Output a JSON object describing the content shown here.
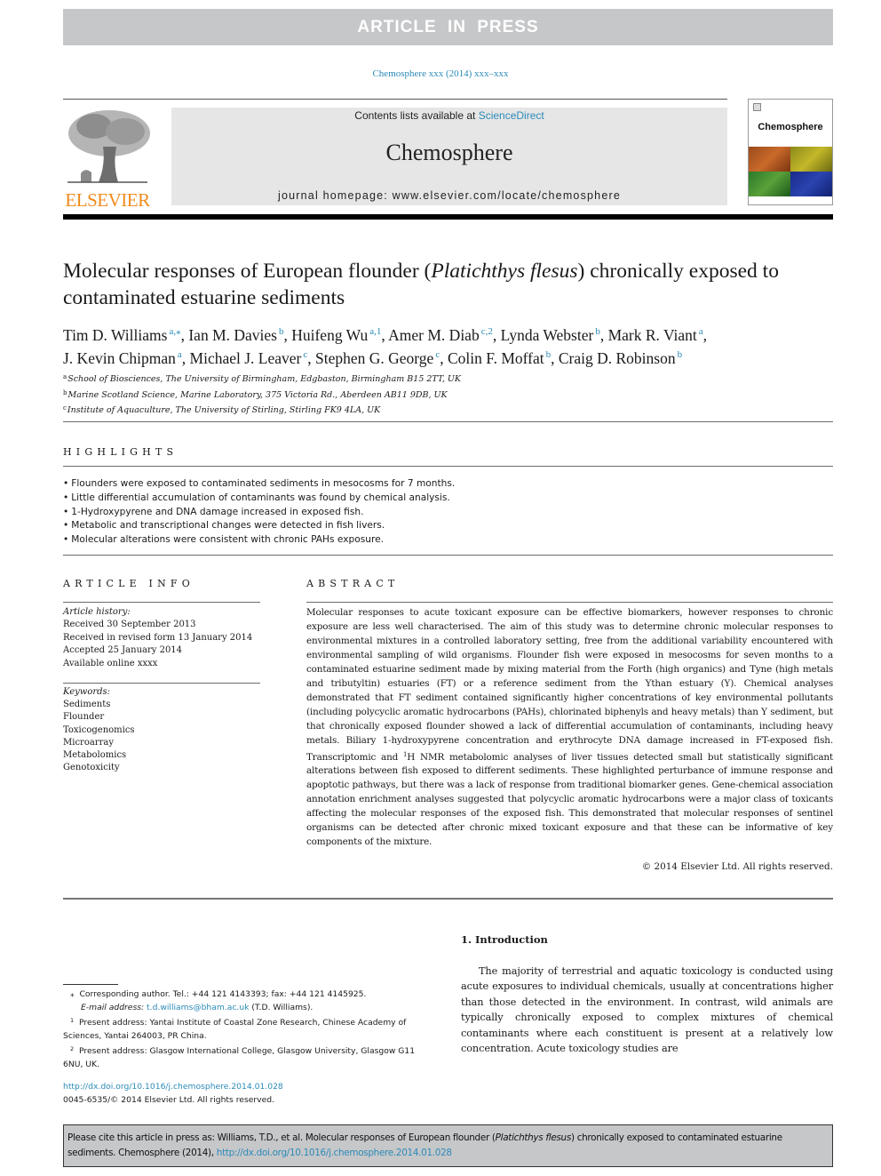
{
  "banner": {
    "label": "ARTICLE IN PRESS"
  },
  "journal_ref": "Chemosphere xxx (2014) xxx–xxx",
  "header": {
    "publisher_logo_text": "ELSEVIER",
    "contents_prefix": "Contents lists available at ",
    "contents_link": "ScienceDirect",
    "journal_title": "Chemosphere",
    "homepage_prefix": "journal homepage: ",
    "homepage_url": "www.elsevier.com/locate/chemosphere",
    "cover_title": "Chemosphere"
  },
  "article": {
    "title_part1": "Molecular responses of European flounder (",
    "title_italic": "Platichthys flesus",
    "title_part2": ") chronically exposed to contaminated estuarine sediments",
    "authors": [
      {
        "name": "Tim D. Williams",
        "sup": "a,⁎",
        "sep": ", "
      },
      {
        "name": "Ian M. Davies",
        "sup": "b",
        "sep": ", "
      },
      {
        "name": "Huifeng Wu",
        "sup": "a,1",
        "sep": ", "
      },
      {
        "name": "Amer M. Diab",
        "sup": "c,2",
        "sep": ", "
      },
      {
        "name": "Lynda Webster",
        "sup": "b",
        "sep": ", "
      },
      {
        "name": "Mark R. Viant",
        "sup": "a",
        "sep": ","
      },
      {
        "name": "J. Kevin Chipman",
        "sup": "a",
        "sep": ", "
      },
      {
        "name": "Michael J. Leaver",
        "sup": "c",
        "sep": ", "
      },
      {
        "name": "Stephen G. George",
        "sup": "c",
        "sep": ", "
      },
      {
        "name": "Colin F. Moffat",
        "sup": "b",
        "sep": ", "
      },
      {
        "name": "Craig D. Robinson",
        "sup": "b",
        "sep": ""
      }
    ],
    "affiliations": [
      {
        "key": "a",
        "text": "School of Biosciences, The University of Birmingham, Edgbaston, Birmingham B15 2TT, UK"
      },
      {
        "key": "b",
        "text": "Marine Scotland Science, Marine Laboratory, 375 Victoria Rd., Aberdeen AB11 9DB, UK"
      },
      {
        "key": "c",
        "text": "Institute of Aquaculture, The University of Stirling, Stirling FK9 4LA, UK"
      }
    ]
  },
  "highlights": {
    "heading": "HIGHLIGHTS",
    "items": [
      "Flounders were exposed to contaminated sediments in mesocosms for 7 months.",
      "Little differential accumulation of contaminants was found by chemical analysis.",
      "1-Hydroxypyrene and DNA damage increased in exposed fish.",
      "Metabolic and transcriptional changes were detected in fish livers.",
      "Molecular alterations were consistent with chronic PAHs exposure."
    ]
  },
  "article_info": {
    "heading": "ARTICLE INFO",
    "history_label": "Article history:",
    "history": [
      "Received 30 September 2013",
      "Received in revised form 13 January 2014",
      "Accepted 25 January 2014",
      "Available online xxxx"
    ],
    "keywords_label": "Keywords:",
    "keywords": [
      "Sediments",
      "Flounder",
      "Toxicogenomics",
      "Microarray",
      "Metabolomics",
      "Genotoxicity"
    ]
  },
  "abstract": {
    "heading": "ABSTRACT",
    "text_before_sup": "Molecular responses to acute toxicant exposure can be effective biomarkers, however responses to chronic exposure are less well characterised. The aim of this study was to determine chronic molecular responses to environmental mixtures in a controlled laboratory setting, free from the additional variabil­ity encountered with environmental sampling of wild organisms. Flounder fish were exposed in meso­cosms for seven months to a contaminated estuarine sediment made by mixing material from the Forth (high organics) and Tyne (high metals and tributyltin) estuaries (FT) or a reference sediment from the Ythan estuary (Y). Chemical analyses demonstrated that FT sediment contained significantly higher concentrations of key environmental pollutants (including polycyclic aromatic hydrocarbons (PAHs), chlorinated biphenyls and heavy metals) than Y sediment, but that chronically exposed flounder showed a lack of differential accumulation of contaminants, including heavy metals. Biliary 1-hydroxypyrene concentration and erythrocyte DNA damage increased in FT-exposed fish. Transcriptomic and ",
    "sup": "1",
    "text_after_sup": "H NMR metabolomic analyses of liver tissues detected small but statistically significant alterations between fish exposed to different sediments. These highlighted perturbance of immune response and apoptotic path­ways, but there was a lack of response from traditional biomarker genes. Gene-chemical association annotation enrichment analyses suggested that polycyclic aromatic hydrocarbons were a major class of toxicants affecting the molecular responses of the exposed fish. This demonstrated that molecular responses of sentinel organisms can be detected after chronic mixed toxicant exposure and that these can be informative of key components of the mixture.",
    "copyright": "© 2014 Elsevier Ltd. All rights reserved."
  },
  "introduction": {
    "heading": "1. Introduction",
    "text": "The majority of terrestrial and aquatic toxicology is conducted using acute exposures to individual chemicals, usually at concen­trations higher than those detected in the environment. In con­trast, wild animals are typically chronically exposed to complex mixtures of chemical contaminants where each constituent is pres­ent at a relatively low concentration. Acute toxicology studies are"
  },
  "footnotes": {
    "corresponding_mark": "⁎",
    "corresponding": "Corresponding author. Tel.: +44 121 4143393; fax: +44 121 4145925.",
    "email_label": "E-mail address:",
    "email": "t.d.williams@bham.ac.uk",
    "email_suffix": " (T.D. Williams).",
    "notes": [
      {
        "mark": "1",
        "text": "Present address: Yantai Institute of Coastal Zone Research, Chinese Academy of Sciences, Yantai 264003, PR China."
      },
      {
        "mark": "2",
        "text": "Present address: Glasgow International College, Glasgow University, Glasgow G11 6NU, UK."
      }
    ],
    "doi_url": "http://dx.doi.org/10.1016/j.chemosphere.2014.01.028",
    "issn_line": "0045-6535/© 2014 Elsevier Ltd. All rights reserved."
  },
  "cite_box": {
    "prefix": "Please cite this article in press as: Williams, T.D., et al. Molecular responses of European flounder (",
    "italic": "Platichthys flesus",
    "middle": ") chronically exposed to contaminated estuarine sediments. Chemosphere (2014), ",
    "link": "http://dx.doi.org/10.1016/j.chemosphere.2014.01.028"
  }
}
